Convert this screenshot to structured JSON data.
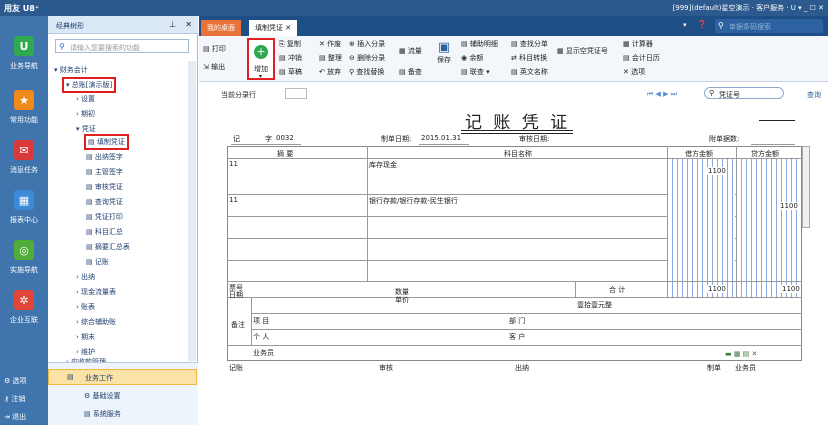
{
  "titlebar": {
    "logo": "用友 U8⁺",
    "info": "[999](default)星空演示  ·  客户服务 · U ▾ _ ☐ ✕"
  },
  "nav": {
    "items": [
      "业务导航",
      "常用功能",
      "消息任务",
      "报表中心",
      "实施导航",
      "企业互联"
    ],
    "bottom": [
      "选项",
      "注销",
      "退出"
    ]
  },
  "sidebar": {
    "title": "经典树形",
    "search_placeholder": "请输入您要搜索的功能",
    "tree": [
      {
        "label": "财务会计",
        "level": 0
      },
      {
        "label": "总账[演示版]",
        "level": 1
      },
      {
        "label": "设置",
        "level": 2
      },
      {
        "label": "期初",
        "level": 2
      },
      {
        "label": "凭证",
        "level": 2
      },
      {
        "label": "填制凭证",
        "level": 3
      },
      {
        "label": "出纳签字",
        "level": 3
      },
      {
        "label": "主管签字",
        "level": 3
      },
      {
        "label": "审核凭证",
        "level": 3
      },
      {
        "label": "查询凭证",
        "level": 3
      },
      {
        "label": "凭证打印",
        "level": 3
      },
      {
        "label": "科目汇总",
        "level": 3
      },
      {
        "label": "摘要汇总表",
        "level": 3
      },
      {
        "label": "记账",
        "level": 3
      },
      {
        "label": "出纳",
        "level": 2
      },
      {
        "label": "现金流量表",
        "level": 2
      },
      {
        "label": "账表",
        "level": 2
      },
      {
        "label": "综合辅助账",
        "level": 2
      },
      {
        "label": "期末",
        "level": 2
      },
      {
        "label": "维护",
        "level": 2
      },
      {
        "label": "应收款管理",
        "level": 1
      }
    ],
    "bottom": [
      "业务工作",
      "基础设置",
      "系统服务"
    ]
  },
  "tabs": [
    "我的桌面",
    "填制凭证"
  ],
  "search_placeholder": "单据条码搜索",
  "ribbon": {
    "col1": [
      "打印",
      "输出"
    ],
    "add": "增加",
    "col2": [
      "复制",
      "冲销",
      "草稿"
    ],
    "col3": [
      "作废",
      "整理",
      "放弃"
    ],
    "col4": [
      "插入分录",
      "删除分录",
      "查找替换"
    ],
    "col5": [
      "流量",
      "备查"
    ],
    "save": "保存",
    "col6": [
      "辅助明细",
      "余额",
      "联查"
    ],
    "col7": [
      "查找分单",
      "科目转换",
      "英文名称"
    ],
    "display": "显示空凭证号",
    "col8": [
      "计算器",
      "会计日历",
      "选项"
    ]
  },
  "voucher": {
    "current_entry_label": "当前分录行",
    "title": "记 账 凭 证",
    "type": "记",
    "no_label": "字",
    "no": "0032",
    "make_date_label": "制单日期:",
    "make_date": "2015.01.31",
    "audit_date_label": "审核日期:",
    "attach_label": "附单据数:",
    "nav_search": "凭证号",
    "query": "查询",
    "col_summary": "摘 要",
    "col_subject": "科目名称",
    "col_debit": "借方金额",
    "col_credit": "贷方金额",
    "rows": [
      {
        "summary": "11",
        "subject": "库存现金",
        "debit": "1100",
        "credit": ""
      },
      {
        "summary": "11",
        "subject": "银行存款/银行存款-民生银行",
        "debit": "",
        "credit": "1100"
      }
    ],
    "ticket_no": "票号",
    "date": "日期",
    "qty": "数量",
    "unit_price": "单价",
    "total_label": "合 计",
    "total_debit": "1100",
    "total_credit": "1100",
    "total_words": "壹拾壹元整",
    "remark": "备注",
    "project": "项 目",
    "dept": "部 门",
    "person": "个 人",
    "customer": "客 户",
    "salesman": "业务员",
    "footer": [
      "记账",
      "审核",
      "出纳",
      "制单",
      "业务员"
    ]
  }
}
